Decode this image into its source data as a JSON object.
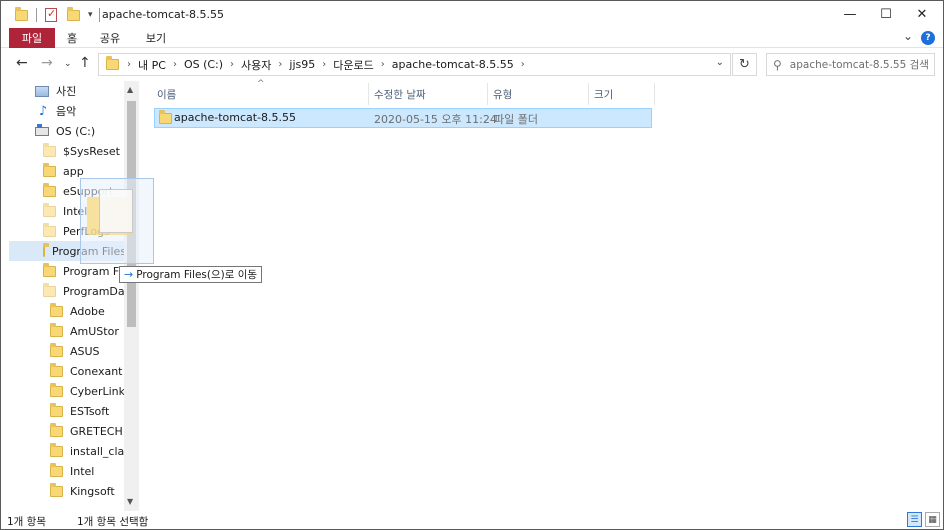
{
  "window": {
    "title": "apache-tomcat-8.5.55",
    "minimize": "—",
    "maximize": "☐",
    "close": "✕"
  },
  "ribbon": {
    "tabs": [
      "파일",
      "홈",
      "공유",
      "보기"
    ],
    "active_tab": "파일"
  },
  "address": {
    "breadcrumbs": [
      "내 PC",
      "OS (C:)",
      "사용자",
      "jjs95",
      "다운로드",
      "apache-tomcat-8.5.55"
    ],
    "search_placeholder": "apache-tomcat-8.5.55 검색"
  },
  "navigation": {
    "items": [
      {
        "label": "사진",
        "icon": "pictures-icon"
      },
      {
        "label": "음악",
        "icon": "music-icon"
      },
      {
        "label": "OS (C:)",
        "icon": "drive-icon"
      },
      {
        "label": "$SysReset",
        "icon": "folder-icon"
      },
      {
        "label": "app",
        "icon": "folder-icon"
      },
      {
        "label": "eSupport",
        "icon": "folder-icon"
      },
      {
        "label": "Intel",
        "icon": "folder-icon"
      },
      {
        "label": "PerfLogs",
        "icon": "folder-icon"
      },
      {
        "label": "Program Files",
        "icon": "folder-icon"
      },
      {
        "label": "Program Files",
        "icon": "folder-icon"
      },
      {
        "label": "ProgramData",
        "icon": "folder-icon"
      },
      {
        "label": "Adobe",
        "icon": "folder-icon"
      },
      {
        "label": "AmUStor",
        "icon": "folder-icon"
      },
      {
        "label": "ASUS",
        "icon": "folder-icon"
      },
      {
        "label": "Conexant",
        "icon": "folder-icon"
      },
      {
        "label": "CyberLink",
        "icon": "folder-icon"
      },
      {
        "label": "ESTsoft",
        "icon": "folder-icon"
      },
      {
        "label": "GRETECH",
        "icon": "folder-icon"
      },
      {
        "label": "install_clap",
        "icon": "folder-icon"
      },
      {
        "label": "Intel",
        "icon": "folder-icon"
      },
      {
        "label": "Kingsoft",
        "icon": "folder-icon"
      }
    ]
  },
  "columns": {
    "name": "이름",
    "modified": "수정한 날짜",
    "type": "유형",
    "size": "크기"
  },
  "files": [
    {
      "name": "apache-tomcat-8.5.55",
      "modified": "2020-05-15 오후 11:24",
      "type": "파일 폴더",
      "size": ""
    }
  ],
  "drag": {
    "tooltip": "Program Files(으)로 이동"
  },
  "status": {
    "item_count": "1개 항목",
    "selected": "1개 항목 선택함"
  }
}
